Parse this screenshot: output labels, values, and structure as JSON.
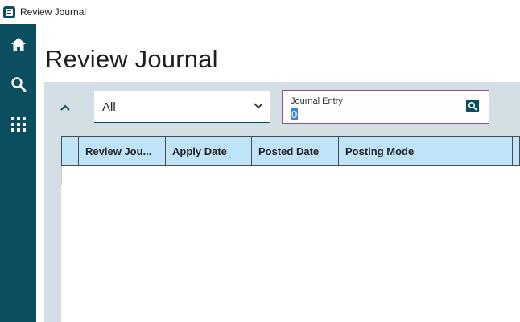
{
  "window": {
    "title": "Review Journal",
    "logo_icon": "app-logo-icon"
  },
  "sidebar": {
    "background": "#0b4e60",
    "items": [
      {
        "name": "home",
        "icon": "home-icon"
      },
      {
        "name": "search",
        "icon": "search-icon"
      },
      {
        "name": "apps",
        "icon": "grid-icon"
      }
    ]
  },
  "page": {
    "title": "Review Journal"
  },
  "filters": {
    "collapse_icon": "chevron-up-icon",
    "select": {
      "value": "All",
      "icon": "chevron-down-icon"
    },
    "journal_entry": {
      "label": "Journal Entry",
      "value": "0",
      "icon": "search-icon"
    }
  },
  "grid": {
    "columns": [
      {
        "label": ""
      },
      {
        "label": "Review Jou..."
      },
      {
        "label": "Apply Date"
      },
      {
        "label": "Posted Date"
      },
      {
        "label": "Posting Mode"
      },
      {
        "label": ""
      }
    ],
    "rows": []
  },
  "colors": {
    "accent": "#0b4e60",
    "header_bg": "#bfe3f8",
    "panel_bg": "#d3dfe5",
    "focus_border": "#9b4b8e",
    "selection": "#3b84d8"
  }
}
